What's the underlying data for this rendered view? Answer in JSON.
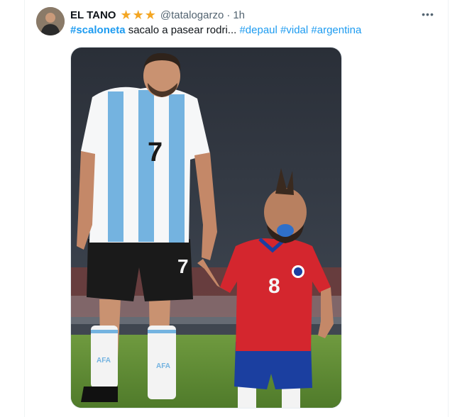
{
  "tweet": {
    "author_name": "EL TANO",
    "badge_stars": 3,
    "star_symbol": "★",
    "handle": "@tatalogarzo",
    "separator": "·",
    "time": "1h",
    "more_label": "•••",
    "text_parts": [
      {
        "type": "hashtag",
        "text": "#scaloneta",
        "bold": true
      },
      {
        "type": "text",
        "text": " sacalo a pasear rodri... "
      },
      {
        "type": "hashtag",
        "text": "#depaul"
      },
      {
        "type": "text",
        "text": " "
      },
      {
        "type": "hashtag",
        "text": "#vidal"
      },
      {
        "type": "text",
        "text": " "
      },
      {
        "type": "hashtag",
        "text": "#argentina"
      }
    ],
    "image": {
      "jersey_left_number": "7",
      "shorts_left_number": "7",
      "jersey_right_number": "8",
      "sock_left_text": "AFA",
      "sock_right_text": "AFA"
    }
  },
  "colors": {
    "link": "#1d9bf0",
    "muted": "#536471",
    "star": "#f4a623",
    "argentina_blue": "#74b3e0",
    "chile_red": "#d4262e",
    "chile_blue": "#1b3fa0"
  }
}
